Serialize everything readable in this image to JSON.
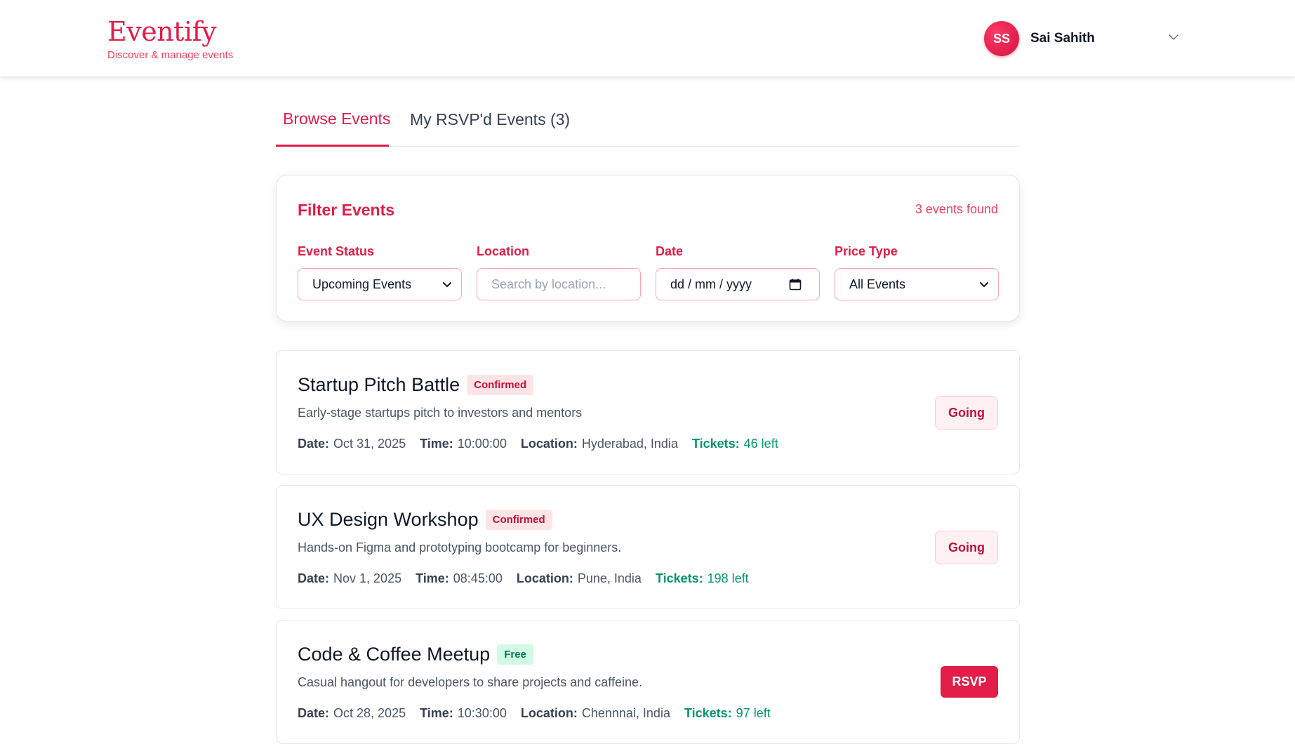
{
  "brand": {
    "title": "Eventify",
    "subtitle": "Discover & manage events"
  },
  "user": {
    "initials": "SS",
    "name": "Sai Sahith"
  },
  "tabs": [
    {
      "label": "Browse Events",
      "active": true
    },
    {
      "label": "My RSVP'd Events (3)",
      "active": false
    }
  ],
  "filter": {
    "title": "Filter Events",
    "count": "3 events found",
    "status": {
      "label": "Event Status",
      "value": "Upcoming Events"
    },
    "location": {
      "label": "Location",
      "placeholder": "Search by location..."
    },
    "date": {
      "label": "Date",
      "value": "dd / mm / yyyy"
    },
    "price": {
      "label": "Price Type",
      "value": "All Events"
    }
  },
  "labels": {
    "date": "Date:",
    "time": "Time:",
    "location": "Location:",
    "tickets": "Tickets:"
  },
  "events": [
    {
      "title": "Startup Pitch Battle",
      "badge": "Confirmed",
      "description": "Early-stage startups pitch to investors and mentors",
      "date": "Oct 31, 2025",
      "time": "10:00:00",
      "location": "Hyderabad, India",
      "tickets": "46 left",
      "action": "Going"
    },
    {
      "title": "UX Design Workshop",
      "badge": "Confirmed",
      "description": "Hands-on Figma and prototyping bootcamp for beginners.",
      "date": "Nov 1, 2025",
      "time": "08:45:00",
      "location": "Pune, India",
      "tickets": "198 left",
      "action": "Going"
    },
    {
      "title": "Code & Coffee Meetup",
      "badge": "Free",
      "description": "Casual hangout for developers to share projects and caffeine.",
      "date": "Oct 28, 2025",
      "time": "10:30:00",
      "location": "Chennnai, India",
      "tickets": "97 left",
      "action": "RSVP"
    }
  ],
  "colors": {
    "accent": "#e11d48",
    "success": "#059669",
    "muted": "#4b5563"
  },
  "icons": {
    "user_menu": "chevron-down-icon",
    "date_picker": "calendar-icon",
    "select": "chevron-down-icon"
  }
}
